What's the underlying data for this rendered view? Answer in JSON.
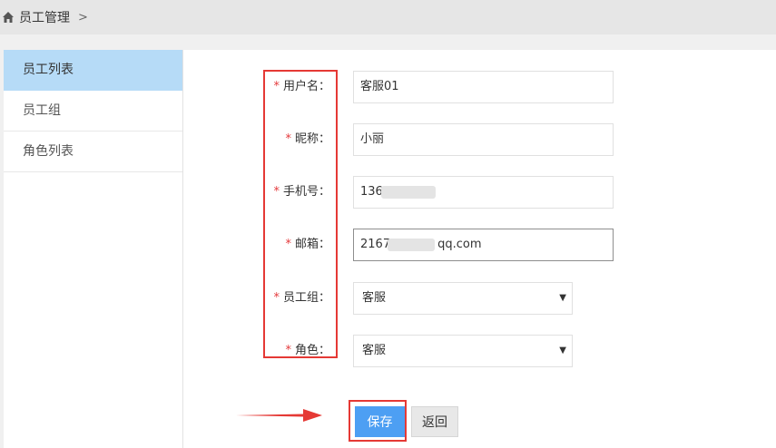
{
  "breadcrumb": {
    "title": "员工管理",
    "chevron": ">"
  },
  "sidebar": {
    "items": [
      {
        "label": "员工列表",
        "active": true
      },
      {
        "label": "员工组",
        "active": false
      },
      {
        "label": "角色列表",
        "active": false
      }
    ]
  },
  "form": {
    "required_mark": "*",
    "username": {
      "label": "用户名：",
      "value": "客服01"
    },
    "nickname": {
      "label": "昵称：",
      "value": "小丽"
    },
    "phone": {
      "label": "手机号：",
      "value": "136"
    },
    "email": {
      "label": "邮箱：",
      "value_prefix": "2167",
      "value_suffix": "qq.com"
    },
    "group": {
      "label": "员工组：",
      "value": "客服"
    },
    "role": {
      "label": "角色：",
      "value": "客服"
    }
  },
  "actions": {
    "save_label": "保存",
    "back_label": "返回"
  },
  "colors": {
    "accent": "#4d9ff3",
    "highlight": "#e53935",
    "required": "#e4393c",
    "active_bg": "#b6dbf7"
  }
}
